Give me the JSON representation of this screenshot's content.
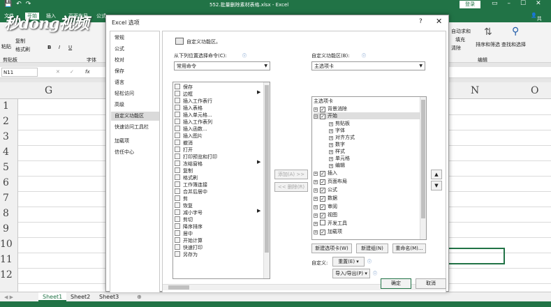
{
  "window": {
    "title": "552.批量删除素材表格.xlsx - Excel",
    "login": "登录",
    "share": "共享",
    "menu": [
      "文件",
      "开始",
      "插入",
      "页面布局",
      "公式"
    ]
  },
  "ribbon": {
    "paste": "粘贴",
    "copy": "复制",
    "format_painter": "格式刷",
    "clipboard": "剪贴板",
    "font": "字体",
    "bold": "B",
    "italic": "I",
    "underline": "U",
    "auto_sum": "自动求和",
    "fill": "填充",
    "clear": "清除",
    "sort_filter": "排序和筛选",
    "find_select": "查找和选择",
    "editing": "编辑"
  },
  "formula": {
    "namebox": "N11",
    "fx": "fx"
  },
  "sheet": {
    "columns": [
      "G",
      "N",
      "O"
    ],
    "rows": [
      "1",
      "2",
      "3",
      "4",
      "5",
      "6",
      "7",
      "8",
      "9",
      "10",
      "11",
      "12"
    ],
    "tabs": [
      "Sheet1",
      "Sheet2",
      "Sheet3"
    ],
    "add_tab": "⊕"
  },
  "watermark": {
    "text_a": "秒",
    "text_b": "dong",
    "text_c": "视频"
  },
  "dialog": {
    "title": "Excel 选项",
    "help": "?",
    "close": "✕",
    "categories": [
      "常规",
      "公式",
      "校对",
      "保存",
      "语言",
      "轻松访问",
      "高级",
      "自定义功能区",
      "快速访问工具栏",
      "加载项",
      "信任中心"
    ],
    "selected_category": "自定义功能区",
    "heading": "自定义功能区。",
    "left_label": "从下列位置选择命令(C):",
    "left_combo": "常用命令",
    "right_label": "自定义功能区(B):",
    "right_combo": "主选项卡",
    "commands": [
      "保存",
      "边框",
      "插入工作表行",
      "插入表格",
      "插入单元格...",
      "插入工作表列",
      "插入函数...",
      "插入图片",
      "撤消",
      "打开",
      "打印预览和打印",
      "冻结窗格",
      "复制",
      "格式刷",
      "工作簿连接",
      "合并后居中",
      "剪",
      "恢复",
      "减小字号",
      "剪切",
      "降序排序",
      "居中",
      "开始计算",
      "快速打印",
      "另存为"
    ],
    "add_button": "添加(A) >>",
    "remove_button": "<< 删除(R)",
    "tree_header": "主选项卡",
    "tree": [
      {
        "level": 0,
        "exp": "+",
        "checked": true,
        "label": "背景消除"
      },
      {
        "level": 0,
        "exp": "−",
        "checked": true,
        "label": "开始"
      },
      {
        "level": 1,
        "exp": "+",
        "checked": null,
        "label": "剪贴板"
      },
      {
        "level": 1,
        "exp": "+",
        "checked": null,
        "label": "字体"
      },
      {
        "level": 1,
        "exp": "+",
        "checked": null,
        "label": "对齐方式"
      },
      {
        "level": 1,
        "exp": "+",
        "checked": null,
        "label": "数字"
      },
      {
        "level": 1,
        "exp": "+",
        "checked": null,
        "label": "样式"
      },
      {
        "level": 1,
        "exp": "+",
        "checked": null,
        "label": "单元格"
      },
      {
        "level": 1,
        "exp": "+",
        "checked": null,
        "label": "编辑"
      },
      {
        "level": 0,
        "exp": "+",
        "checked": true,
        "label": "插入"
      },
      {
        "level": 0,
        "exp": "+",
        "checked": true,
        "label": "页面布局"
      },
      {
        "level": 0,
        "exp": "+",
        "checked": true,
        "label": "公式"
      },
      {
        "level": 0,
        "exp": "+",
        "checked": true,
        "label": "数据"
      },
      {
        "level": 0,
        "exp": "+",
        "checked": true,
        "label": "审阅"
      },
      {
        "level": 0,
        "exp": "+",
        "checked": true,
        "label": "视图"
      },
      {
        "level": 0,
        "exp": "+",
        "checked": false,
        "label": "开发工具"
      },
      {
        "level": 0,
        "exp": "+",
        "checked": true,
        "label": "加载项"
      }
    ],
    "move_up": "▲",
    "move_down": "▼",
    "new_tab": "新建选项卡(W)",
    "new_group": "新建组(N)",
    "rename": "重命名(M)...",
    "customize_label": "自定义:",
    "reset": "重置(E) ▾",
    "import_export": "导入/导出(P) ▾",
    "ok": "确定",
    "cancel": "取消"
  }
}
